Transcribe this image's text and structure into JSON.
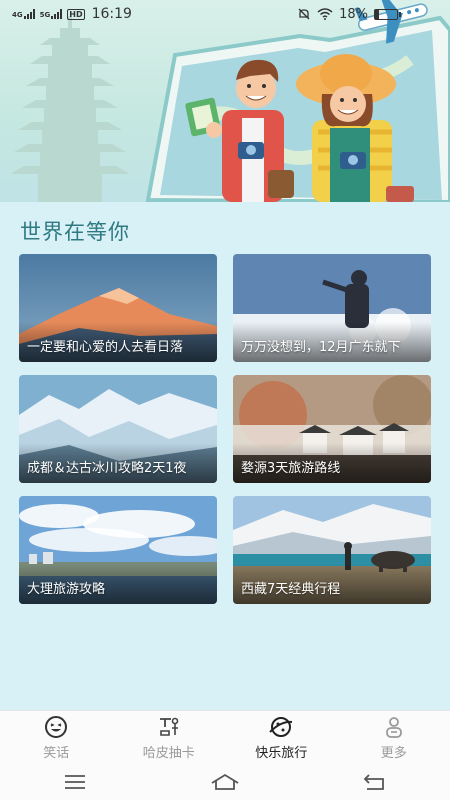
{
  "status_bar": {
    "network_1": "4G",
    "network_2": "5G",
    "hd": "HD",
    "time": "16:19",
    "battery": "18%",
    "battery_level": 0.18
  },
  "section": {
    "title": "世界在等你"
  },
  "cards": [
    {
      "caption": "一定要和心爱的人去看日落",
      "image": "snow-mountain-sunset"
    },
    {
      "caption": "万万没想到，12月广东就下",
      "image": "person-in-snowy-field"
    },
    {
      "caption": "成都＆达古冰川攻略2天1夜",
      "image": "snowy-mountain-valley"
    },
    {
      "caption": "婺源3天旅游路线",
      "image": "misty-village"
    },
    {
      "caption": "大理旅游攻略",
      "image": "dali-lake-clouds"
    },
    {
      "caption": "西藏7天经典行程",
      "image": "tibet-yak-lake"
    }
  ],
  "tabs": [
    {
      "label": "笑话",
      "icon": "laugh-face-icon",
      "active": false
    },
    {
      "label": "哈皮抽卡",
      "icon": "card-draw-icon",
      "active": false
    },
    {
      "label": "快乐旅行",
      "icon": "travel-planet-icon",
      "active": true
    },
    {
      "label": "更多",
      "icon": "person-more-icon",
      "active": false
    }
  ],
  "nav": {
    "menu_icon": "menu-icon",
    "home_icon": "home-icon",
    "back_icon": "back-icon"
  },
  "colors": {
    "background": "#d8f1f6",
    "title": "#2f7a82",
    "tab_active": "#222222",
    "tab_inactive": "#9a9a9a"
  }
}
